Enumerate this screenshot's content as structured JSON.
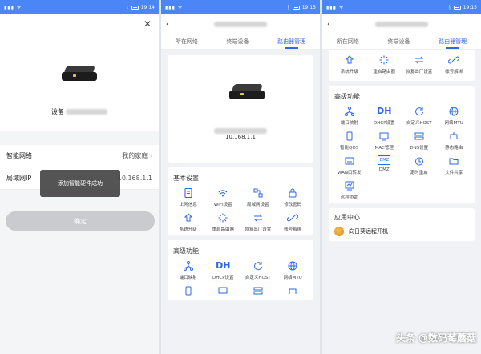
{
  "status": {
    "time1": "19:14",
    "time2": "19:15",
    "time3": "19:15"
  },
  "panel1": {
    "device_label": "设备",
    "rows": [
      {
        "label": "智能网络",
        "value": "我的家庭"
      },
      {
        "label": "局域网IP",
        "value": "10.168.1.1"
      }
    ],
    "toast": "添加智能硬件成功",
    "confirm": "确定"
  },
  "tabs": [
    "所在网络",
    "终端设备",
    "路由器管理"
  ],
  "panel2": {
    "ip": "10.168.1.1",
    "basic_title": "基本设置",
    "basic": [
      "上网信息",
      "WIFI设置",
      "局域网设置",
      "修改密码",
      "系统升级",
      "重启路由器",
      "恢复出厂设置",
      "帐号解绑"
    ],
    "adv_title": "高级功能",
    "adv": [
      "端口映射",
      "DHCP设置",
      "自定义HOST",
      "网络MTU"
    ]
  },
  "panel3": {
    "top": [
      "系统升级",
      "重启路由器",
      "恢复出厂设置",
      "帐号解绑"
    ],
    "adv_title": "高级功能",
    "adv": [
      "端口映射",
      "DHCP设置",
      "自定义HOST",
      "网络MTU",
      "智能QOS",
      "MAC管理",
      "DNS设置",
      "静态路由",
      "WAN口转发",
      "DMZ",
      "定时重启",
      "文件共享",
      "远程协助"
    ],
    "app_title": "应用中心",
    "app_item": "向日葵远程开机",
    "dh_text": "DH",
    "dmz_text": "DMZ"
  },
  "watermark": "头条 @数码莓蘑菇",
  "colors": {
    "statusbar": "#4a86f5",
    "accent": "#2b67e6"
  }
}
